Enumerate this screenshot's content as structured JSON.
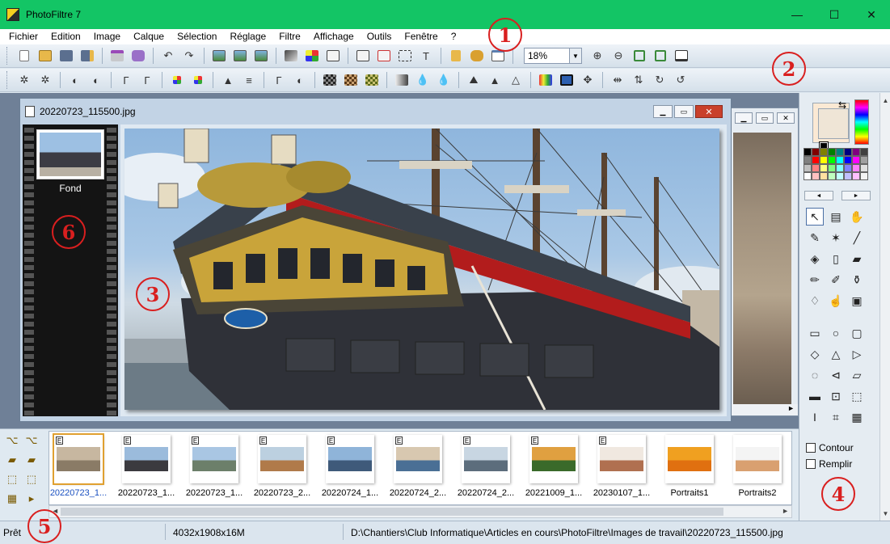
{
  "window": {
    "title": "PhotoFiltre 7",
    "minimize": "—",
    "maximize": "☐",
    "close": "✕"
  },
  "menu": [
    "Fichier",
    "Edition",
    "Image",
    "Calque",
    "Sélection",
    "Réglage",
    "Filtre",
    "Affichage",
    "Outils",
    "Fenêtre",
    "?"
  ],
  "toolbar": {
    "zoom": "18%",
    "zoom_arrow": "▼"
  },
  "document": {
    "title": "20220723_115500.jpg",
    "layer_name": "Fond"
  },
  "annotations": {
    "c1": "1",
    "c2": "2",
    "c3": "3",
    "c4": "4",
    "c5": "5",
    "c6": "6"
  },
  "tools": {
    "contour_label": "Contour",
    "remplir_label": "Remplir"
  },
  "browser": {
    "thumbnails": [
      {
        "caption": "20220723_1...",
        "badge": "E",
        "colors": [
          "#c7b7a0",
          "#8a7b66"
        ],
        "selected": true
      },
      {
        "caption": "20220723_1...",
        "badge": "E",
        "colors": [
          "#9bbbdc",
          "#3b3a3f"
        ]
      },
      {
        "caption": "20220723_1...",
        "badge": "E",
        "colors": [
          "#a9c6e3",
          "#6c7f6a"
        ]
      },
      {
        "caption": "20220723_2...",
        "badge": "E",
        "colors": [
          "#bcd0e0",
          "#b07a4a"
        ]
      },
      {
        "caption": "20220724_1...",
        "badge": "E",
        "colors": [
          "#8fb4d9",
          "#3f5a7a"
        ]
      },
      {
        "caption": "20220724_2...",
        "badge": "E",
        "colors": [
          "#d8c8b0",
          "#4a6f95"
        ]
      },
      {
        "caption": "20220724_2...",
        "badge": "E",
        "colors": [
          "#c8d6e2",
          "#5c6d7c"
        ]
      },
      {
        "caption": "20221009_1...",
        "badge": "E",
        "colors": [
          "#e0a040",
          "#3a6a2a"
        ]
      },
      {
        "caption": "20230107_1...",
        "badge": "E",
        "colors": [
          "#f0e8e0",
          "#b07050"
        ]
      },
      {
        "caption": "Portraits1",
        "badge": "",
        "colors": [
          "#f0a020",
          "#e07010"
        ]
      },
      {
        "caption": "Portraits2",
        "badge": "",
        "colors": [
          "#f4f4f4",
          "#d9a070"
        ]
      }
    ]
  },
  "status": {
    "state": "Prêt",
    "dimensions": "4032x1908x16M",
    "path": "D:\\Chantiers\\Club Informatique\\Articles en cours\\PhotoFiltre\\Images de travail\\20220723_115500.jpg"
  },
  "colors": {
    "titlebar": "#13c565",
    "callout": "#d91f1f",
    "workspace": "#6f8097"
  }
}
